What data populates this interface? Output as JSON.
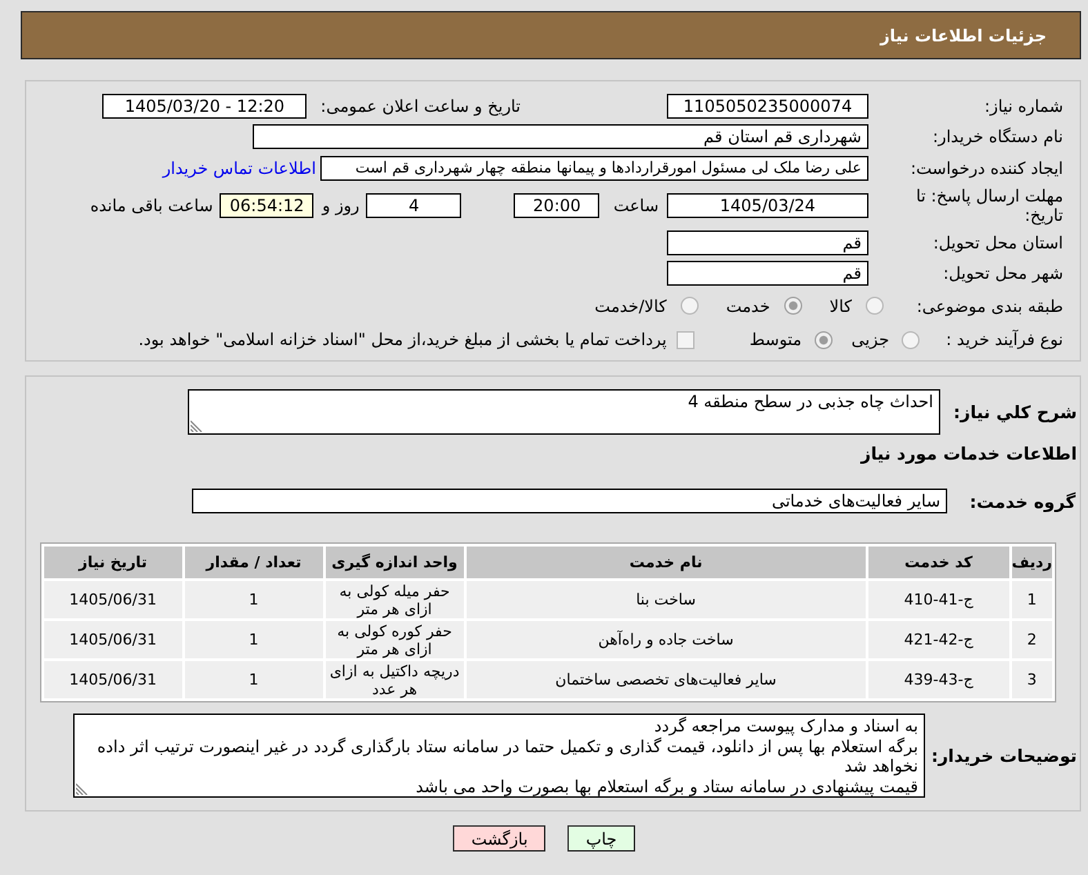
{
  "page_title": "جزئیات اطلاعات نیاز",
  "details": {
    "need_number": {
      "label": "شماره نیاز:",
      "value": "1105050235000074"
    },
    "announce_datetime": {
      "label": "تاریخ و ساعت اعلان عمومی:",
      "value": "1405/03/20 - 12:20"
    },
    "buyer_org": {
      "label": "نام دستگاه خریدار:",
      "value": "شهرداری قم استان قم"
    },
    "requester": {
      "label": "ایجاد کننده درخواست:",
      "value": "علی رضا ملک لی مسئول امورقراردادها و پیمانها منطقه چهار  شهرداری قم است",
      "link": "اطلاعات تماس خریدار"
    },
    "deadline": {
      "label": "مهلت ارسال پاسخ: تا تاریخ:",
      "date": "1405/03/24",
      "time_label": "ساعت",
      "time": "20:00",
      "days": "4",
      "days_label": "روز و",
      "remaining": "06:54:12",
      "remaining_label": "ساعت باقی مانده"
    },
    "delivery_province": {
      "label": "استان محل تحویل:",
      "value": "قم"
    },
    "delivery_city": {
      "label": "شهر محل تحویل:",
      "value": "قم"
    },
    "category": {
      "label": "طبقه بندی موضوعی:",
      "options": [
        {
          "label": "کالا",
          "selected": false
        },
        {
          "label": "خدمت",
          "selected": true
        },
        {
          "label": "کالا/خدمت",
          "selected": false
        }
      ]
    },
    "purchase_type": {
      "label": "نوع فرآیند خرید :",
      "options": [
        {
          "label": "جزیی",
          "selected": false
        },
        {
          "label": "متوسط",
          "selected": true
        }
      ],
      "treasury_payment": {
        "label": "پرداخت تمام یا بخشی از مبلغ خرید،از محل \"اسناد خزانه اسلامی\" خواهد بود.",
        "checked": false
      }
    }
  },
  "requirements": {
    "description_label": "شرح کلي نیاز:",
    "description": "احداث چاه جذبی در سطح منطقه 4",
    "services_heading": "اطلاعات خدمات مورد نیاز",
    "service_group_label": "گروه خدمت:",
    "service_group": "سایر فعالیت‌های خدماتی",
    "table": {
      "columns": [
        "ردیف",
        "کد خدمت",
        "نام خدمت",
        "واحد اندازه گیری",
        "تعداد / مقدار",
        "تاریخ نیاز"
      ],
      "rows": [
        [
          "1",
          "ج-41-410",
          "ساخت بنا",
          "حفر میله کولی به ازای هر متر",
          "1",
          "1405/06/31"
        ],
        [
          "2",
          "ج-42-421",
          "ساخت جاده و راه‌آهن",
          "حفر کوره کولی به ازای هر متر",
          "1",
          "1405/06/31"
        ],
        [
          "3",
          "ج-43-439",
          "سایر فعالیت‌های تخصصی ساختمان",
          "دریچه داکتیل به ازای هر عدد",
          "1",
          "1405/06/31"
        ]
      ]
    },
    "buyer_notes_label": "توضیحات خریدار:",
    "buyer_notes": [
      "به اسناد و مدارک پیوست مراجعه گردد",
      "برگه استعلام بها پس از دانلود، قیمت گذاری و تکمیل حتما در سامانه ستاد بارگذاری گردد در غیر اینصورت ترتیب اثر داده نخواهد شد",
      "قیمت پیشنهادی در سامانه ستاد و برگه استعلام بها بصورت واحد می باشد"
    ]
  },
  "buttons": [
    {
      "label": "چاپ",
      "kind": "print"
    },
    {
      "label": "بازگشت",
      "kind": "back"
    }
  ]
}
